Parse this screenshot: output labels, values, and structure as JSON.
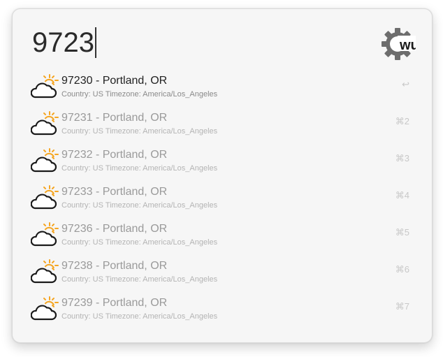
{
  "search": {
    "query": "9723"
  },
  "logo": {
    "text": "wu",
    "icon": "wunderground-gear-logo-icon"
  },
  "results": [
    {
      "title": "97230 - Portland, OR",
      "subtitle": "Country: US Timezone: America/Los_Angeles",
      "shortcut": "↩",
      "selected": true,
      "icon": "partly-cloudy-icon"
    },
    {
      "title": "97231 - Portland, OR",
      "subtitle": "Country: US Timezone: America/Los_Angeles",
      "shortcut": "⌘2",
      "selected": false,
      "icon": "partly-cloudy-icon"
    },
    {
      "title": "97232 - Portland, OR",
      "subtitle": "Country: US Timezone: America/Los_Angeles",
      "shortcut": "⌘3",
      "selected": false,
      "icon": "partly-cloudy-icon"
    },
    {
      "title": "97233 - Portland, OR",
      "subtitle": "Country: US Timezone: America/Los_Angeles",
      "shortcut": "⌘4",
      "selected": false,
      "icon": "partly-cloudy-icon"
    },
    {
      "title": "97236 - Portland, OR",
      "subtitle": "Country: US Timezone: America/Los_Angeles",
      "shortcut": "⌘5",
      "selected": false,
      "icon": "partly-cloudy-icon"
    },
    {
      "title": "97238 - Portland, OR",
      "subtitle": "Country: US Timezone: America/Los_Angeles",
      "shortcut": "⌘6",
      "selected": false,
      "icon": "partly-cloudy-icon"
    },
    {
      "title": "97239 - Portland, OR",
      "subtitle": "Country: US Timezone: America/Los_Angeles",
      "shortcut": "⌘7",
      "selected": false,
      "icon": "partly-cloudy-icon"
    }
  ],
  "colors": {
    "sun": "#f5a623",
    "cloud_outline": "#1a1a1a",
    "logo_gear": "#6d6d6d"
  }
}
